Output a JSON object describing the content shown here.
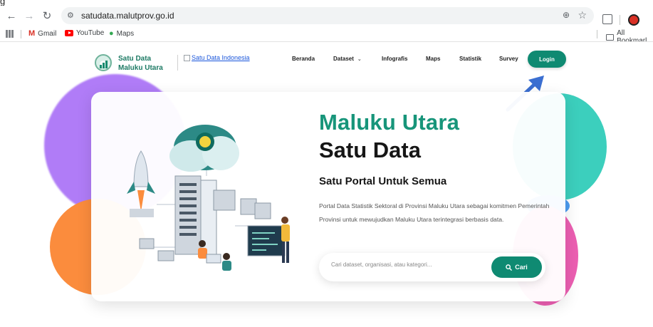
{
  "browser": {
    "top_fragment": "g",
    "url": "satudata.malutprov.go.id",
    "bookmarks": [
      "Gmail",
      "YouTube",
      "Maps"
    ],
    "all_bookmarks": "All Bookmarl"
  },
  "header": {
    "logo_line1": "Satu Data",
    "logo_line2": "Maluku Utara",
    "partner_logo_alt": "Satu Data Indonesia",
    "nav": [
      "Beranda",
      "Dataset",
      "Infografis",
      "Maps",
      "Statistik",
      "Survey"
    ],
    "login_label": "Login"
  },
  "hero": {
    "title_line1": "Maluku Utara",
    "title_line2": "Satu Data",
    "subtitle": "Satu Portal Untuk Semua",
    "description": "Portal Data Statistik Sektoral di Provinsi Maluku Utara sebagai komitmen Pemerintah Provinsi untuk mewujudkan Maluku Utara terintegrasi berbasis data."
  },
  "search": {
    "placeholder": "Cari dataset, organisasi, atau kategori...",
    "button_label": "Cari"
  },
  "colors": {
    "brand_green": "#0f8a72",
    "title_green": "#17957a",
    "annotation_arrow": "#3b6fd1"
  }
}
